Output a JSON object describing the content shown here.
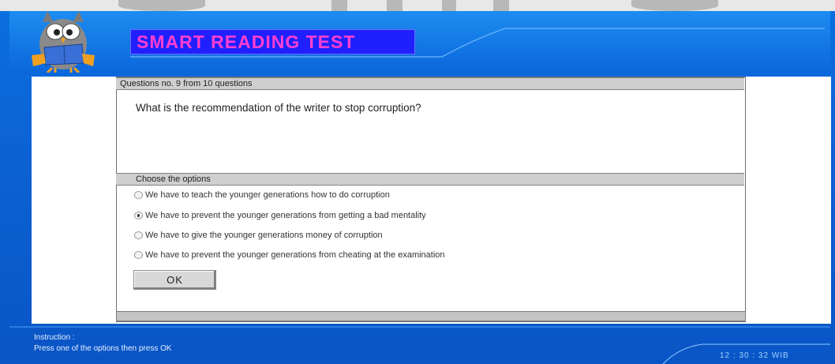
{
  "app": {
    "title": "SMART READING TEST"
  },
  "question": {
    "counter": "Questions no. 9 from 10 questions",
    "text": "What is the recommendation of the writer to stop corruption?"
  },
  "choices": {
    "header": "Choose the options",
    "options": [
      {
        "label": "We have to teach the younger generations how to do corruption",
        "selected": false
      },
      {
        "label": "We have to prevent the younger generations from getting a bad mentality",
        "selected": true
      },
      {
        "label": "We have to give the younger generations money of corruption",
        "selected": false
      },
      {
        "label": "We have to prevent the younger generations from cheating at the examination",
        "selected": false
      }
    ]
  },
  "actions": {
    "ok_label": "OK"
  },
  "footer": {
    "instruction_label": "Instruction :",
    "instruction_text": "Press one of the options then press OK",
    "clock": "12 : 30 : 32  WIB"
  },
  "colors": {
    "background_blue": "#0b62d4",
    "title_box": "#2020ff",
    "title_text": "#ff3fd0",
    "panel_bar": "#cfcfcf"
  },
  "icons": {
    "mascot": "owl-reading-book-icon"
  }
}
